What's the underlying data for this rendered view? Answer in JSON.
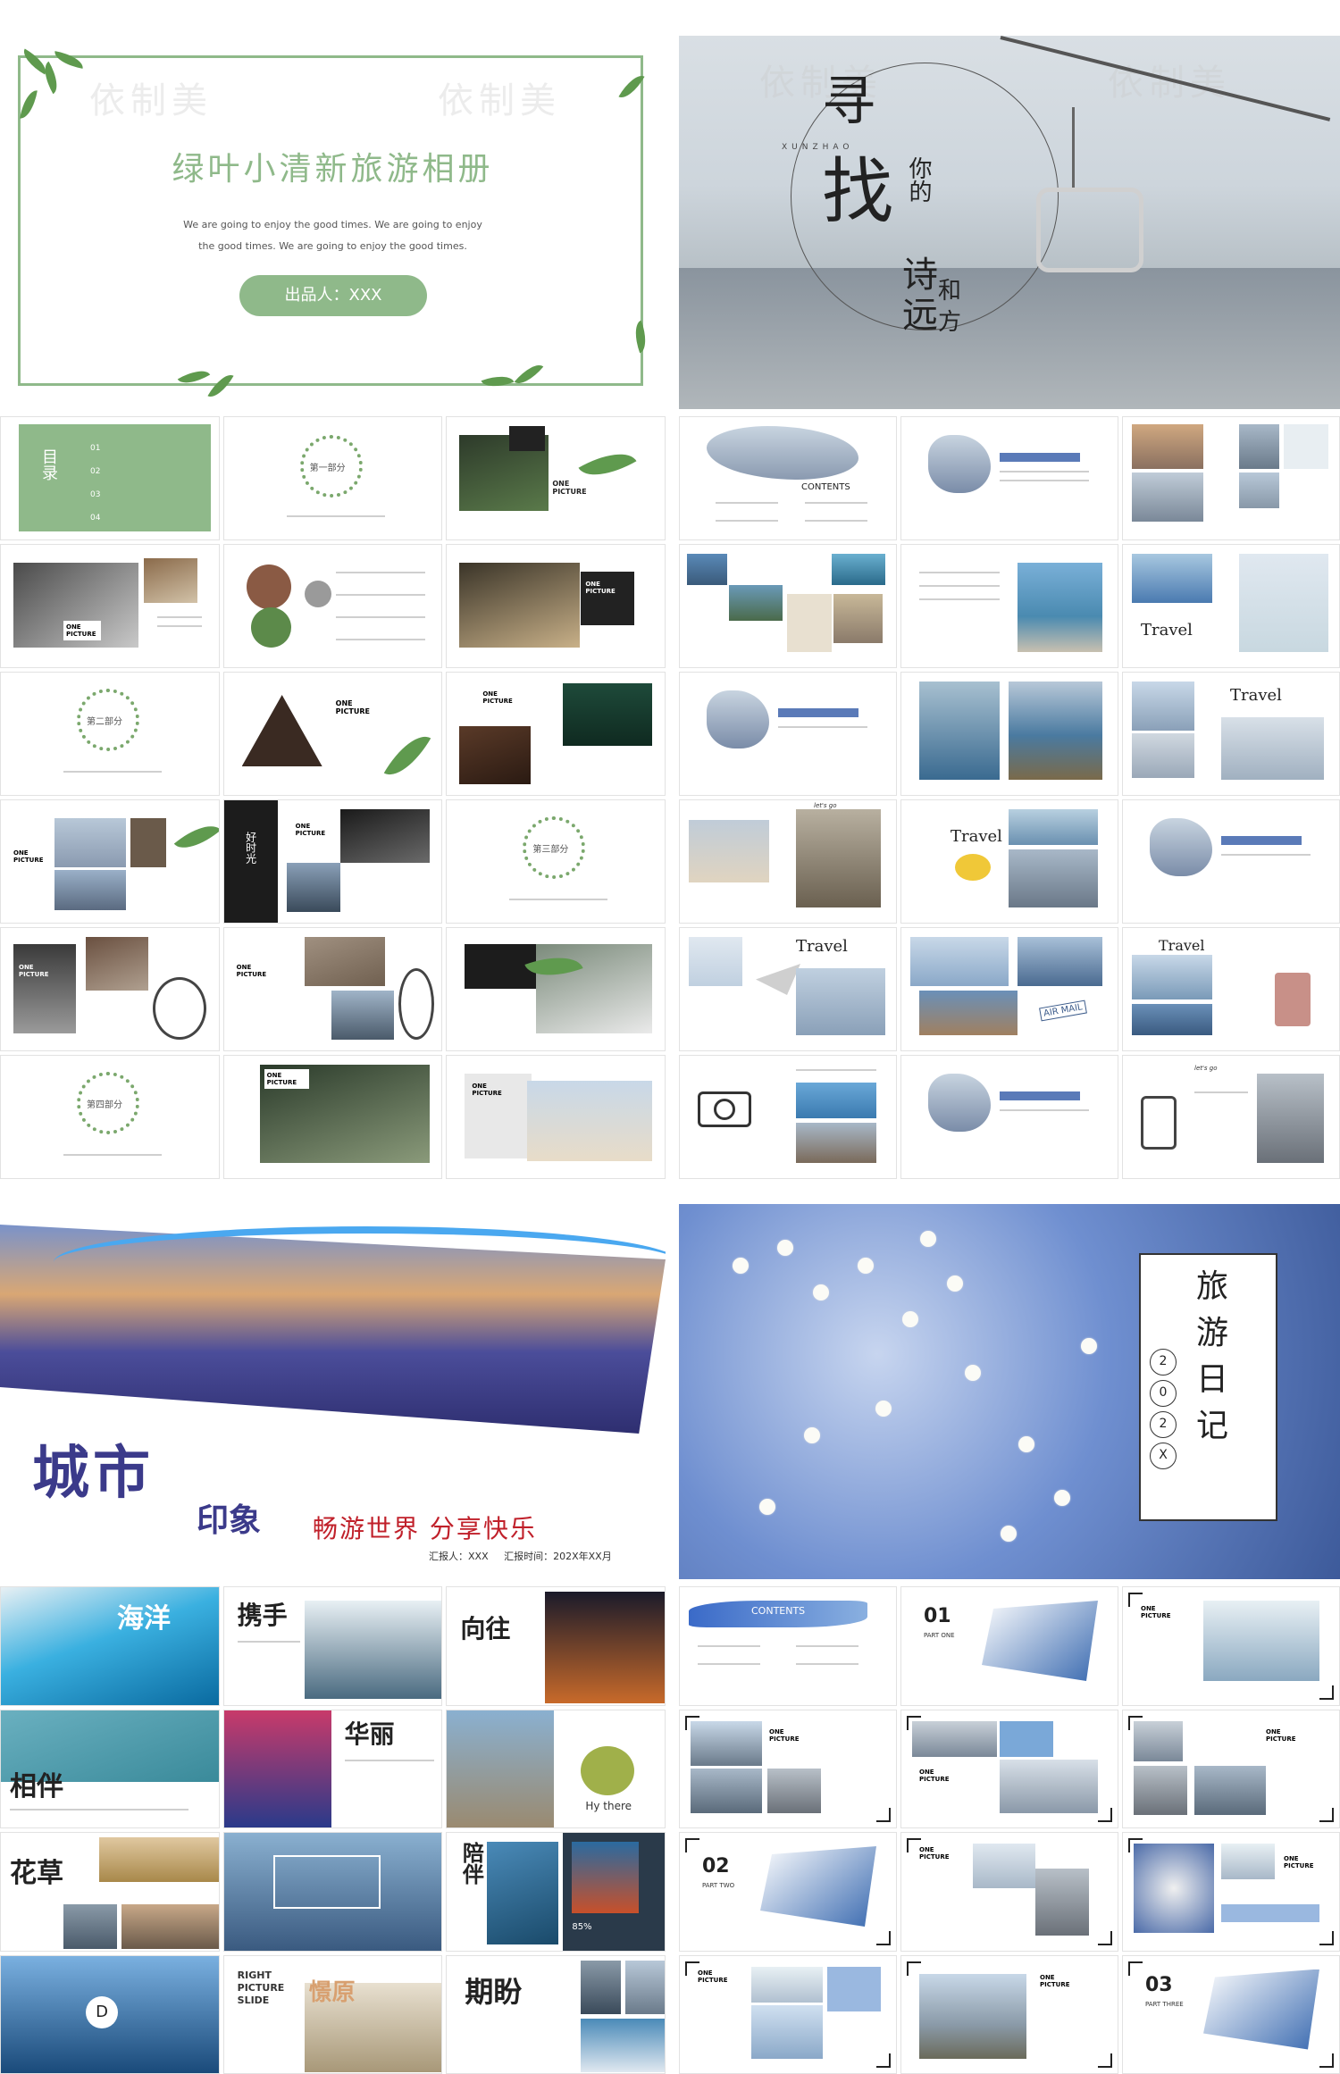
{
  "q1": {
    "watermark": [
      "依制美",
      "依制美",
      "依制美",
      "依制美"
    ],
    "title": "绿叶小清新旅游相册",
    "subtitle_lines": [
      "We are going to enjoy the good times. We are going to enjoy",
      "the good times. We are going to enjoy the good times."
    ],
    "presenter": "出品人：XXX",
    "toc_label": "目录",
    "toc_items": [
      "01",
      "02",
      "03",
      "04"
    ],
    "section_label": "第一部分",
    "section2_label": "第二部分",
    "section3_label": "第三部分",
    "section4_label": "第四部分",
    "one_picture": "ONE PICTURE",
    "good_time": "好时光"
  },
  "q2": {
    "title_chars": [
      "寻",
      "找"
    ],
    "pinyin": "XUNZHAO",
    "ni_de": "你的",
    "shi": "诗",
    "he": "和",
    "yuan": "远",
    "fang": "方",
    "watermark": [
      "依制美",
      "依制美"
    ],
    "contents": "CONTENTS",
    "travel": "Travel",
    "airmail": "AIR MAIL",
    "lets_go": "let's go"
  },
  "q3": {
    "city": "城市",
    "impression": "印象",
    "slogan": "畅游世界  分享快乐",
    "reporter": "汇报人：XXX",
    "date": "汇报时间：202X年XX月",
    "keywords": [
      "海洋",
      "携手",
      "向往",
      "相伴",
      "华丽",
      "花草",
      "陪伴",
      "期盼",
      "憬原"
    ],
    "hy_there": "Hy there",
    "right_picture": "RIGHT PICTURE SLIDE",
    "percent": "85%",
    "d_letter": "D"
  },
  "q4": {
    "title_chars": [
      "旅",
      "游",
      "日",
      "记"
    ],
    "year_chars": [
      "2",
      "0",
      "2",
      "X"
    ],
    "contents": "CONTENTS",
    "part_one_num": "01",
    "part_one": "PART ONE",
    "part_two_num": "02",
    "part_two": "PART TWO",
    "part_three_num": "03",
    "part_three": "PART THREE",
    "one_picture": "ONE PICTURE"
  }
}
